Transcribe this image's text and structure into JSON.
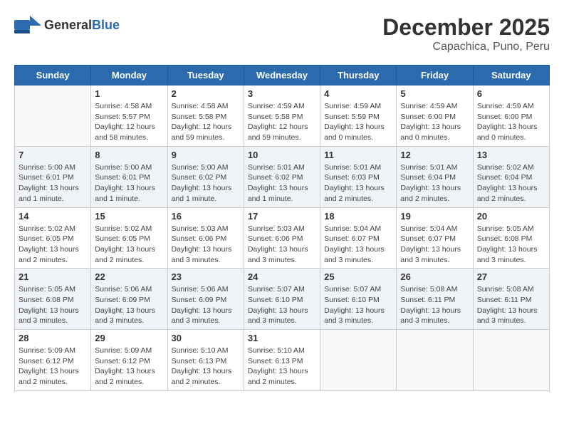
{
  "header": {
    "logo_general": "General",
    "logo_blue": "Blue",
    "month_title": "December 2025",
    "subtitle": "Capachica, Puno, Peru"
  },
  "days_of_week": [
    "Sunday",
    "Monday",
    "Tuesday",
    "Wednesday",
    "Thursday",
    "Friday",
    "Saturday"
  ],
  "weeks": [
    [
      {
        "day": "",
        "info": ""
      },
      {
        "day": "1",
        "info": "Sunrise: 4:58 AM\nSunset: 5:57 PM\nDaylight: 12 hours\nand 58 minutes."
      },
      {
        "day": "2",
        "info": "Sunrise: 4:58 AM\nSunset: 5:58 PM\nDaylight: 12 hours\nand 59 minutes."
      },
      {
        "day": "3",
        "info": "Sunrise: 4:59 AM\nSunset: 5:58 PM\nDaylight: 12 hours\nand 59 minutes."
      },
      {
        "day": "4",
        "info": "Sunrise: 4:59 AM\nSunset: 5:59 PM\nDaylight: 13 hours\nand 0 minutes."
      },
      {
        "day": "5",
        "info": "Sunrise: 4:59 AM\nSunset: 6:00 PM\nDaylight: 13 hours\nand 0 minutes."
      },
      {
        "day": "6",
        "info": "Sunrise: 4:59 AM\nSunset: 6:00 PM\nDaylight: 13 hours\nand 0 minutes."
      }
    ],
    [
      {
        "day": "7",
        "info": "Sunrise: 5:00 AM\nSunset: 6:01 PM\nDaylight: 13 hours\nand 1 minute."
      },
      {
        "day": "8",
        "info": "Sunrise: 5:00 AM\nSunset: 6:01 PM\nDaylight: 13 hours\nand 1 minute."
      },
      {
        "day": "9",
        "info": "Sunrise: 5:00 AM\nSunset: 6:02 PM\nDaylight: 13 hours\nand 1 minute."
      },
      {
        "day": "10",
        "info": "Sunrise: 5:01 AM\nSunset: 6:02 PM\nDaylight: 13 hours\nand 1 minute."
      },
      {
        "day": "11",
        "info": "Sunrise: 5:01 AM\nSunset: 6:03 PM\nDaylight: 13 hours\nand 2 minutes."
      },
      {
        "day": "12",
        "info": "Sunrise: 5:01 AM\nSunset: 6:04 PM\nDaylight: 13 hours\nand 2 minutes."
      },
      {
        "day": "13",
        "info": "Sunrise: 5:02 AM\nSunset: 6:04 PM\nDaylight: 13 hours\nand 2 minutes."
      }
    ],
    [
      {
        "day": "14",
        "info": "Sunrise: 5:02 AM\nSunset: 6:05 PM\nDaylight: 13 hours\nand 2 minutes."
      },
      {
        "day": "15",
        "info": "Sunrise: 5:02 AM\nSunset: 6:05 PM\nDaylight: 13 hours\nand 2 minutes."
      },
      {
        "day": "16",
        "info": "Sunrise: 5:03 AM\nSunset: 6:06 PM\nDaylight: 13 hours\nand 3 minutes."
      },
      {
        "day": "17",
        "info": "Sunrise: 5:03 AM\nSunset: 6:06 PM\nDaylight: 13 hours\nand 3 minutes."
      },
      {
        "day": "18",
        "info": "Sunrise: 5:04 AM\nSunset: 6:07 PM\nDaylight: 13 hours\nand 3 minutes."
      },
      {
        "day": "19",
        "info": "Sunrise: 5:04 AM\nSunset: 6:07 PM\nDaylight: 13 hours\nand 3 minutes."
      },
      {
        "day": "20",
        "info": "Sunrise: 5:05 AM\nSunset: 6:08 PM\nDaylight: 13 hours\nand 3 minutes."
      }
    ],
    [
      {
        "day": "21",
        "info": "Sunrise: 5:05 AM\nSunset: 6:08 PM\nDaylight: 13 hours\nand 3 minutes."
      },
      {
        "day": "22",
        "info": "Sunrise: 5:06 AM\nSunset: 6:09 PM\nDaylight: 13 hours\nand 3 minutes."
      },
      {
        "day": "23",
        "info": "Sunrise: 5:06 AM\nSunset: 6:09 PM\nDaylight: 13 hours\nand 3 minutes."
      },
      {
        "day": "24",
        "info": "Sunrise: 5:07 AM\nSunset: 6:10 PM\nDaylight: 13 hours\nand 3 minutes."
      },
      {
        "day": "25",
        "info": "Sunrise: 5:07 AM\nSunset: 6:10 PM\nDaylight: 13 hours\nand 3 minutes."
      },
      {
        "day": "26",
        "info": "Sunrise: 5:08 AM\nSunset: 6:11 PM\nDaylight: 13 hours\nand 3 minutes."
      },
      {
        "day": "27",
        "info": "Sunrise: 5:08 AM\nSunset: 6:11 PM\nDaylight: 13 hours\nand 3 minutes."
      }
    ],
    [
      {
        "day": "28",
        "info": "Sunrise: 5:09 AM\nSunset: 6:12 PM\nDaylight: 13 hours\nand 2 minutes."
      },
      {
        "day": "29",
        "info": "Sunrise: 5:09 AM\nSunset: 6:12 PM\nDaylight: 13 hours\nand 2 minutes."
      },
      {
        "day": "30",
        "info": "Sunrise: 5:10 AM\nSunset: 6:13 PM\nDaylight: 13 hours\nand 2 minutes."
      },
      {
        "day": "31",
        "info": "Sunrise: 5:10 AM\nSunset: 6:13 PM\nDaylight: 13 hours\nand 2 minutes."
      },
      {
        "day": "",
        "info": ""
      },
      {
        "day": "",
        "info": ""
      },
      {
        "day": "",
        "info": ""
      }
    ]
  ]
}
